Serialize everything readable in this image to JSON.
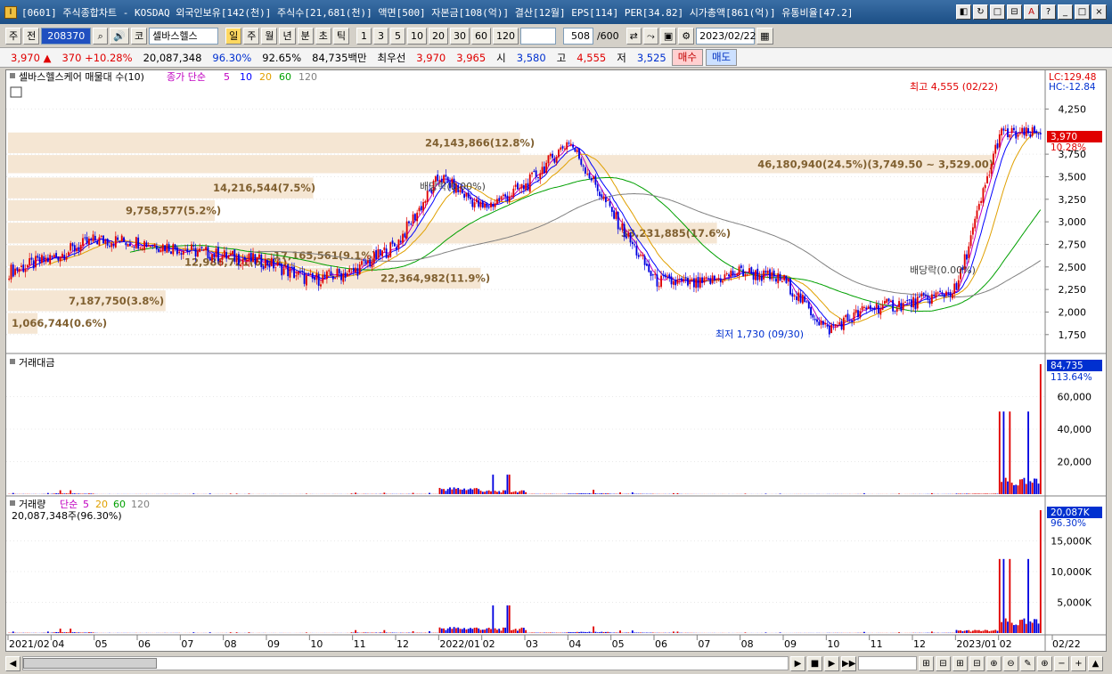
{
  "window": {
    "title": "[0601] 주식종합차트 - KOSDAQ 외국인보유[142(천)] 주식수[21,681(천)] 액면[500] 자본금[108(억)] 결산[12월] EPS[114] PER[34.82] 시가총액[861(억)] 유통비율[47.2]",
    "buttons": [
      "◧",
      "↻",
      "□",
      "⊟",
      "A",
      "?",
      "_",
      "□",
      "×"
    ]
  },
  "toolbar": {
    "period_select": "주",
    "prev": "전",
    "code": "208370",
    "search_icon": "⌕",
    "speaker_icon": "🔊",
    "market": "코",
    "stock_name": "셀바스헬스",
    "periods": [
      "일",
      "주",
      "월",
      "년",
      "분",
      "초",
      "틱"
    ],
    "selected_period": "일",
    "intervals": [
      "1",
      "3",
      "5",
      "10",
      "20",
      "30",
      "60",
      "120"
    ],
    "count": "508",
    "count_total": "/600",
    "date": "2023/02/22"
  },
  "quote": {
    "price": "3,970",
    "arrow": "▲",
    "change": "370",
    "rate": "+10.28%",
    "volume": "20,087,348",
    "vol_rate1": "96.30%",
    "vol_rate2": "92.65%",
    "amount": "84,735백만",
    "best_label": "최우선",
    "best_ask": "3,970",
    "best_bid": "3,965",
    "open_label": "시",
    "open": "3,580",
    "high_label": "고",
    "high": "4,555",
    "low_label": "저",
    "low": "3,525",
    "buy": "매수",
    "sell": "매도"
  },
  "price_panel": {
    "legend_title": "셀바스헬스케어 매물대 수(10)",
    "legend_ma": "종가 단순",
    "ma_periods": [
      "5",
      "10",
      "20",
      "60",
      "120"
    ],
    "ma_colors": [
      "#c000c0",
      "#0000ff",
      "#e0a000",
      "#00a000",
      "#808080"
    ],
    "lc": "LC:129.48",
    "hc": "HC:-12.84",
    "current_price": "3,970",
    "current_rate": "10.28%",
    "high_note": "최고 4,555 (02/22)",
    "low_note": "최저 1,730 (09/30)",
    "dividend1": "배당락(0.00%)",
    "dividend2": "배당락(0.00%)",
    "yaxis": [
      "4,250",
      "3,750",
      "3,500",
      "3,250",
      "3,000",
      "2,750",
      "2,500",
      "2,250",
      "2,000",
      "1,750"
    ],
    "volume_profile": [
      {
        "label": "46,180,940(24.5%)(3,749.50 ~ 3,529.00)"
      },
      {
        "label": "33,231,885(17.6%)"
      },
      {
        "label": "24,143,866(12.8%)"
      },
      {
        "label": "22,364,982(11.9%)"
      },
      {
        "label": "17,165,561(9.1%)"
      },
      {
        "label": "14,216,544(7.5%)"
      },
      {
        "label": "12,986,721(6.9%)"
      },
      {
        "label": "9,758,577(5.2%)"
      },
      {
        "label": "7,187,750(3.8%)"
      },
      {
        "label": "1,066,744(0.6%)"
      }
    ]
  },
  "amount_panel": {
    "legend": "거래대금",
    "current": "84,735",
    "rate": "113.64%",
    "yaxis": [
      "60,000",
      "40,000",
      "20,000"
    ]
  },
  "volume_panel": {
    "legend": "거래량",
    "legend_ma": "단순",
    "ma_periods": [
      "5",
      "20",
      "60",
      "120"
    ],
    "summary": "20,087,348주(96.30%)",
    "current": "20,087K",
    "rate": "96.30%",
    "yaxis": [
      "15,000K",
      "10,000K",
      "5,000K"
    ]
  },
  "xaxis": [
    "2021/02",
    "04",
    "05",
    "06",
    "07",
    "08",
    "09",
    "10",
    "11",
    "12",
    "2022/01",
    "02",
    "03",
    "04",
    "05",
    "06",
    "07",
    "08",
    "09",
    "10",
    "11",
    "12",
    "2023/01",
    "02",
    "02/22"
  ],
  "status_buttons": [
    "▶",
    "■",
    "▶",
    "▶▶",
    "⊞",
    "⊟",
    "⊞",
    "⊟",
    "⊕",
    "⊖",
    "✎",
    "⊕",
    "⊖",
    "+",
    "+",
    "-",
    "⊕",
    "−",
    "+",
    "▲"
  ],
  "chart_data": {
    "type": "candlestick",
    "title": "셀바스헬스케어",
    "x": [
      "2021/02",
      "04",
      "05",
      "06",
      "07",
      "08",
      "09",
      "10",
      "11",
      "12",
      "2022/01",
      "02",
      "03",
      "04",
      "05",
      "06",
      "07",
      "08",
      "09",
      "10",
      "11",
      "12",
      "2023/01",
      "02"
    ],
    "close": [
      2450,
      2600,
      2800,
      2780,
      2700,
      2620,
      2550,
      2350,
      2450,
      2750,
      3500,
      3150,
      3400,
      3900,
      3100,
      2350,
      2300,
      2450,
      2350,
      1800,
      2050,
      2100,
      2250,
      3970
    ],
    "amount": [
      1200,
      4000,
      800,
      900,
      700,
      600,
      500,
      700,
      1500,
      1300,
      38000,
      20000,
      2000,
      4500,
      1800,
      1000,
      600,
      500,
      700,
      800,
      600,
      1000,
      3000,
      84735
    ],
    "volume_k": [
      400,
      1200,
      300,
      250,
      200,
      200,
      150,
      180,
      800,
      500,
      9000,
      7500,
      800,
      1800,
      700,
      400,
      200,
      150,
      200,
      300,
      200,
      400,
      4500,
      20087
    ],
    "ylim": [
      1600,
      4600
    ],
    "series": [
      {
        "name": "5"
      },
      {
        "name": "10"
      },
      {
        "name": "20"
      },
      {
        "name": "60"
      },
      {
        "name": "120"
      }
    ]
  }
}
